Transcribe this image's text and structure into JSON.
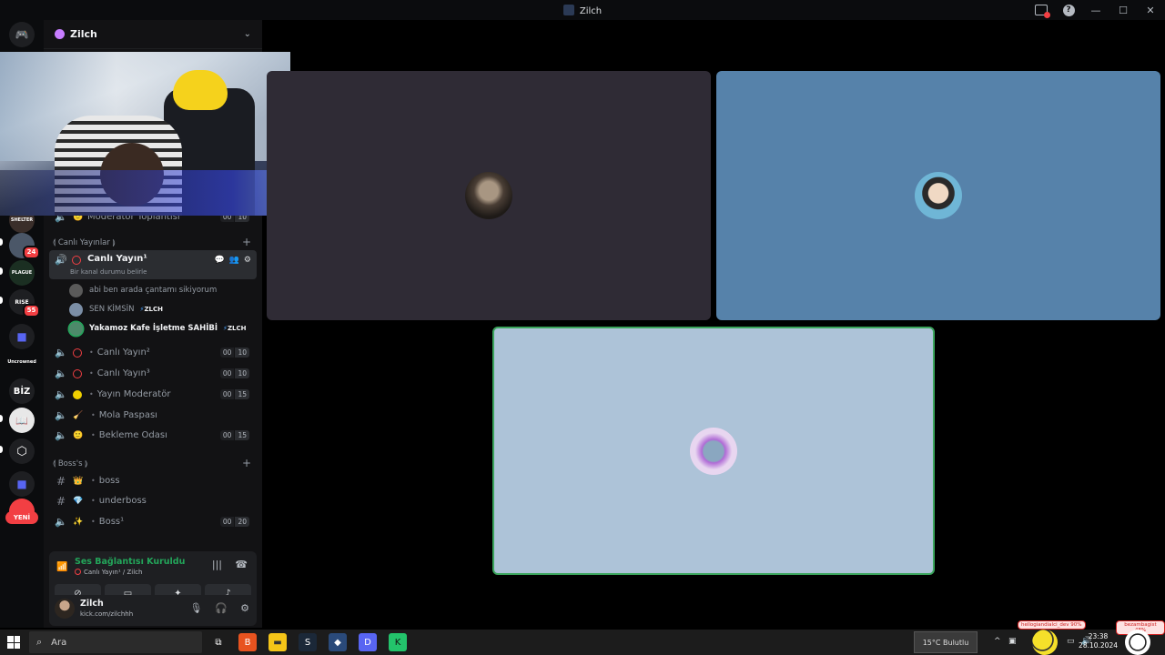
{
  "window": {
    "title": "Zilch"
  },
  "server": {
    "name": "Zilch"
  },
  "rail": {
    "badges": [
      "24",
      "55"
    ],
    "labels": [
      "SHELTER",
      "PLAGUE",
      "RISE",
      "Uncrowned",
      "BİZ"
    ],
    "new_label": "YENİ"
  },
  "categories": {
    "live": "⟬ Canlı Yayınlar ⟭",
    "boss": "⟬ Boss's ⟭"
  },
  "partial_channel": {
    "label": "Moderatör Toplantısı",
    "counts": [
      "00",
      "10"
    ]
  },
  "active_channel": {
    "name": "Canlı Yayın¹",
    "status": "Bir kanal durumu belirle"
  },
  "voice_users": [
    {
      "name": "abi ben arada çantamı sikiyorum",
      "tag": ""
    },
    {
      "name": "SEN KİMSİN",
      "tag": "ZLCH"
    },
    {
      "name": "Yakamoz Kafe İşletme SAHİBİ",
      "tag": "ZLCH"
    }
  ],
  "channels": [
    {
      "name": "Canlı Yayın²",
      "emoji": "ring",
      "counts": [
        "00",
        "10"
      ]
    },
    {
      "name": "Canlı Yayın³",
      "emoji": "ring",
      "counts": [
        "00",
        "10"
      ]
    },
    {
      "name": "Yayın Moderatör",
      "emoji": "yellow",
      "counts": [
        "00",
        "15"
      ]
    },
    {
      "name": "Mola Paspası",
      "emoji": "🧹",
      "counts": []
    },
    {
      "name": "Bekleme Odası",
      "emoji": "🙂",
      "counts": [
        "00",
        "15"
      ]
    }
  ],
  "text_channels": [
    {
      "name": "boss",
      "emoji": "👑"
    },
    {
      "name": "underboss",
      "emoji": "💎"
    }
  ],
  "boss_voice": {
    "name": "Boss¹",
    "emoji": "✨",
    "counts": [
      "00",
      "20"
    ]
  },
  "voice_panel": {
    "title": "Ses Bağlantısı Kuruldu",
    "subtitle": "Canlı Yayın¹ / Zilch"
  },
  "user": {
    "name": "Zilch",
    "status": "kick.com/zilchhh"
  },
  "taskbar": {
    "search_placeholder": "Ara",
    "weather": "15°C Bulutlu",
    "time": "23:38",
    "date": "28.10.2024",
    "bubble_left": "hellogiandialci_dev 90%",
    "bubble_right": "bezambagist 48%"
  },
  "colors": {
    "tile1": "#2f2b35",
    "tile2": "#5682aa",
    "tile3": "#adc3d8",
    "speaking_border": "#3ba55c"
  }
}
